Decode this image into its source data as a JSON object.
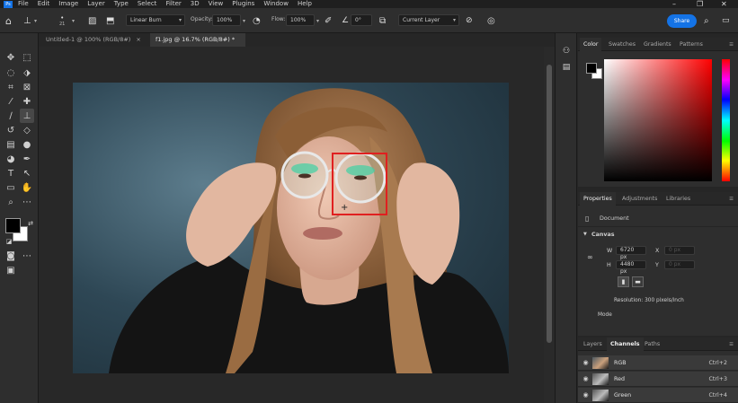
{
  "menu": {
    "items": [
      "File",
      "Edit",
      "Image",
      "Layer",
      "Type",
      "Select",
      "Filter",
      "3D",
      "View",
      "Plugins",
      "Window",
      "Help"
    ]
  },
  "options": {
    "brush_size": "21",
    "blend_mode": "Linear Burn",
    "opacity_label": "Opacity:",
    "opacity_value": "100%",
    "flow_label": "Flow:",
    "flow_value": "100%",
    "angle_value": "0°",
    "sample": "Current Layer",
    "share_label": "Share"
  },
  "tabs": [
    {
      "label": "Untitled-1 @ 100% (RGB/8#)",
      "close": "×"
    },
    {
      "label": "f1.jpg @ 16.7% (RGB/8#) *",
      "close": "×"
    }
  ],
  "color_panel": {
    "tabs": [
      "Color",
      "Swatches",
      "Gradients",
      "Patterns"
    ],
    "foreground": "#000000",
    "background": "#ffffff"
  },
  "properties": {
    "tabs": [
      "Properties",
      "Adjustments",
      "Libraries"
    ],
    "doc_label": "Document",
    "section": "Canvas",
    "w_label": "W",
    "w_value": "6720 px",
    "h_label": "H",
    "h_value": "4480 px",
    "x_label": "X",
    "x_value": "0 px",
    "y_label": "Y",
    "y_value": "0 px",
    "resolution": "Resolution: 300 pixels/inch",
    "mode_label": "Mode"
  },
  "channels": {
    "tabs": [
      "Layers",
      "Channels",
      "Paths"
    ],
    "rows": [
      {
        "name": "RGB",
        "shortcut": "Ctrl+2"
      },
      {
        "name": "Red",
        "shortcut": "Ctrl+3"
      },
      {
        "name": "Green",
        "shortcut": "Ctrl+4"
      }
    ]
  },
  "colors": {
    "accent": "#1473e6",
    "selection": "#e02020"
  }
}
